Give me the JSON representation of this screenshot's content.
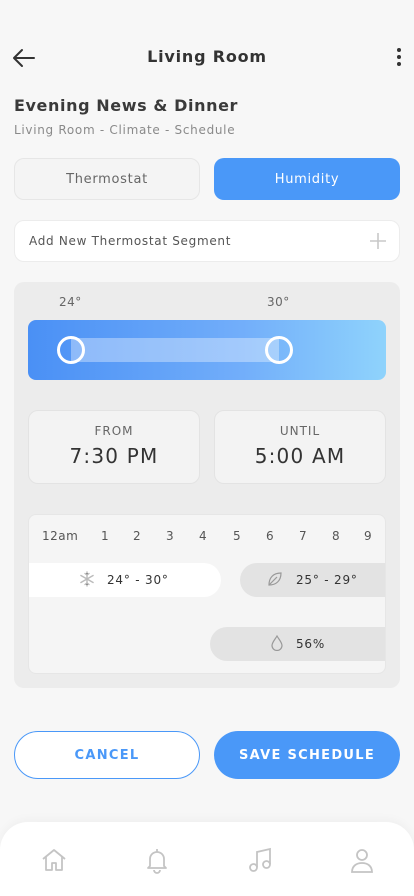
{
  "header": {
    "title": "Living Room"
  },
  "schedule": {
    "title": "Evening News & Dinner",
    "subtitle": "Living Room - Climate - Schedule"
  },
  "tabs": [
    {
      "label": "Thermostat",
      "active": false
    },
    {
      "label": "Humidity",
      "active": true
    }
  ],
  "add_segment": {
    "label": "Add New Thermostat Segment"
  },
  "temperature_range": {
    "min_label": "24°",
    "max_label": "30°",
    "min_fraction": 0.12,
    "max_fraction": 0.7
  },
  "time": {
    "from_caption": "FROM",
    "from_value": "7:30 PM",
    "until_caption": "UNTIL",
    "until_value": "5:00 AM"
  },
  "timeline": {
    "hours": [
      "12am",
      "1",
      "2",
      "3",
      "4",
      "5",
      "6",
      "7",
      "8",
      "9"
    ],
    "segments": [
      {
        "icon": "snowflake-icon",
        "label": "24° - 30°"
      },
      {
        "icon": "leaf-icon",
        "label": "25° - 29°"
      },
      {
        "icon": "droplet-icon",
        "label": "56%"
      }
    ]
  },
  "actions": {
    "cancel": "CANCEL",
    "save": "SAVE SCHEDULE"
  },
  "nav": [
    "home-icon",
    "bell-icon",
    "music-icon",
    "user-icon"
  ],
  "colors": {
    "accent": "#4a98f8",
    "background": "#f7f7f7",
    "panel": "#ececec"
  }
}
